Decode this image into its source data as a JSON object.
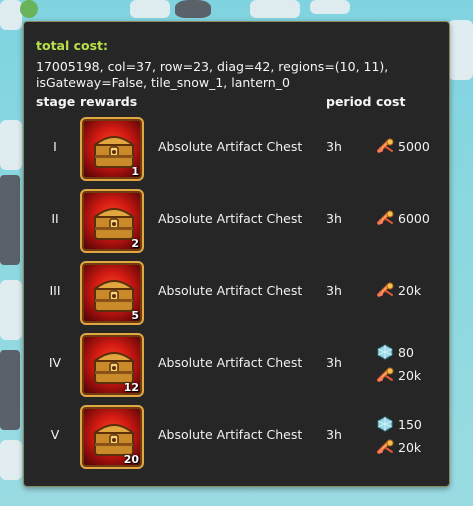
{
  "header": {
    "total_cost_label": "total cost:",
    "info_text": "17005198, col=37, row=23, diag=42, regions=(10, 11), isGateway=False, tile_snow_1, lantern_0"
  },
  "columns": {
    "stage": "stage",
    "rewards": "rewards",
    "period": "period",
    "cost": "cost"
  },
  "rows": [
    {
      "stage": "I",
      "reward_name": "Absolute Artifact Chest",
      "quantity": "1",
      "period": "3h",
      "costs": [
        {
          "icon": "scroll-icon",
          "value": "5000"
        }
      ]
    },
    {
      "stage": "II",
      "reward_name": "Absolute Artifact Chest",
      "quantity": "2",
      "period": "3h",
      "costs": [
        {
          "icon": "scroll-icon",
          "value": "6000"
        }
      ]
    },
    {
      "stage": "III",
      "reward_name": "Absolute Artifact Chest",
      "quantity": "5",
      "period": "3h",
      "costs": [
        {
          "icon": "scroll-icon",
          "value": "20k"
        }
      ]
    },
    {
      "stage": "IV",
      "reward_name": "Absolute Artifact Chest",
      "quantity": "12",
      "period": "3h",
      "costs": [
        {
          "icon": "gem-icon",
          "value": "80"
        },
        {
          "icon": "scroll-icon",
          "value": "20k"
        }
      ]
    },
    {
      "stage": "V",
      "reward_name": "Absolute Artifact Chest",
      "quantity": "20",
      "period": "3h",
      "costs": [
        {
          "icon": "gem-icon",
          "value": "150"
        },
        {
          "icon": "scroll-icon",
          "value": "20k"
        }
      ]
    }
  ],
  "colors": {
    "panel_bg": "#262626",
    "accent_green": "#b8e04a",
    "chest_red": "#d11a12",
    "chest_border": "#e0a640"
  }
}
